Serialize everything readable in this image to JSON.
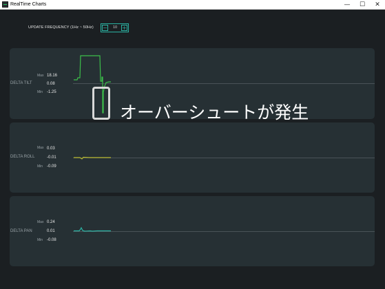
{
  "window": {
    "title": "RealTime Charts",
    "controls": {
      "minimize": "—",
      "maximize": "☐",
      "close": "✕"
    }
  },
  "frequency": {
    "label": "UPDATE FREQUENCY (1Hz ~ 50Hz)",
    "value": "10",
    "decrement": "−",
    "increment": "+"
  },
  "panels": [
    {
      "label": "DELTA TILT",
      "max_label": "Max",
      "max": "18.16",
      "current": "0.08",
      "min_label": "Min",
      "min": "-1.25",
      "color": "#3cbf4a",
      "icon": "line-chart"
    },
    {
      "label": "DELTA ROLL",
      "max_label": "Max",
      "max": "0.03",
      "current": "-0.01",
      "min_label": "Min",
      "min": "-0.09",
      "color": "#b5b52a",
      "icon": "line-chart"
    },
    {
      "label": "DELTA PAN",
      "max_label": "Max",
      "max": "0.24",
      "current": "0.01",
      "min_label": "Min",
      "min": "-0.08",
      "color": "#2bb3a3",
      "icon": "line-chart"
    }
  ],
  "annotation": {
    "text": "オーバーシュートが発生",
    "marker_color": "#d8d8d8"
  },
  "colors": {
    "accent": "#2bb3a3",
    "background": "#1b1f22",
    "panel": "#263034"
  }
}
